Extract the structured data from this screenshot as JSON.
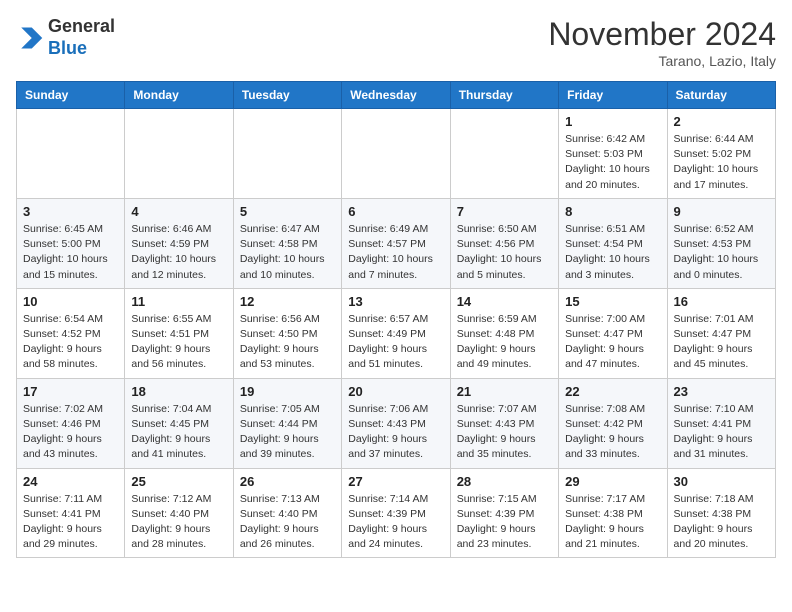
{
  "header": {
    "logo_line1": "General",
    "logo_line2": "Blue",
    "month": "November 2024",
    "location": "Tarano, Lazio, Italy"
  },
  "weekdays": [
    "Sunday",
    "Monday",
    "Tuesday",
    "Wednesday",
    "Thursday",
    "Friday",
    "Saturday"
  ],
  "weeks": [
    [
      {
        "day": "",
        "info": ""
      },
      {
        "day": "",
        "info": ""
      },
      {
        "day": "",
        "info": ""
      },
      {
        "day": "",
        "info": ""
      },
      {
        "day": "",
        "info": ""
      },
      {
        "day": "1",
        "info": "Sunrise: 6:42 AM\nSunset: 5:03 PM\nDaylight: 10 hours\nand 20 minutes."
      },
      {
        "day": "2",
        "info": "Sunrise: 6:44 AM\nSunset: 5:02 PM\nDaylight: 10 hours\nand 17 minutes."
      }
    ],
    [
      {
        "day": "3",
        "info": "Sunrise: 6:45 AM\nSunset: 5:00 PM\nDaylight: 10 hours\nand 15 minutes."
      },
      {
        "day": "4",
        "info": "Sunrise: 6:46 AM\nSunset: 4:59 PM\nDaylight: 10 hours\nand 12 minutes."
      },
      {
        "day": "5",
        "info": "Sunrise: 6:47 AM\nSunset: 4:58 PM\nDaylight: 10 hours\nand 10 minutes."
      },
      {
        "day": "6",
        "info": "Sunrise: 6:49 AM\nSunset: 4:57 PM\nDaylight: 10 hours\nand 7 minutes."
      },
      {
        "day": "7",
        "info": "Sunrise: 6:50 AM\nSunset: 4:56 PM\nDaylight: 10 hours\nand 5 minutes."
      },
      {
        "day": "8",
        "info": "Sunrise: 6:51 AM\nSunset: 4:54 PM\nDaylight: 10 hours\nand 3 minutes."
      },
      {
        "day": "9",
        "info": "Sunrise: 6:52 AM\nSunset: 4:53 PM\nDaylight: 10 hours\nand 0 minutes."
      }
    ],
    [
      {
        "day": "10",
        "info": "Sunrise: 6:54 AM\nSunset: 4:52 PM\nDaylight: 9 hours\nand 58 minutes."
      },
      {
        "day": "11",
        "info": "Sunrise: 6:55 AM\nSunset: 4:51 PM\nDaylight: 9 hours\nand 56 minutes."
      },
      {
        "day": "12",
        "info": "Sunrise: 6:56 AM\nSunset: 4:50 PM\nDaylight: 9 hours\nand 53 minutes."
      },
      {
        "day": "13",
        "info": "Sunrise: 6:57 AM\nSunset: 4:49 PM\nDaylight: 9 hours\nand 51 minutes."
      },
      {
        "day": "14",
        "info": "Sunrise: 6:59 AM\nSunset: 4:48 PM\nDaylight: 9 hours\nand 49 minutes."
      },
      {
        "day": "15",
        "info": "Sunrise: 7:00 AM\nSunset: 4:47 PM\nDaylight: 9 hours\nand 47 minutes."
      },
      {
        "day": "16",
        "info": "Sunrise: 7:01 AM\nSunset: 4:47 PM\nDaylight: 9 hours\nand 45 minutes."
      }
    ],
    [
      {
        "day": "17",
        "info": "Sunrise: 7:02 AM\nSunset: 4:46 PM\nDaylight: 9 hours\nand 43 minutes."
      },
      {
        "day": "18",
        "info": "Sunrise: 7:04 AM\nSunset: 4:45 PM\nDaylight: 9 hours\nand 41 minutes."
      },
      {
        "day": "19",
        "info": "Sunrise: 7:05 AM\nSunset: 4:44 PM\nDaylight: 9 hours\nand 39 minutes."
      },
      {
        "day": "20",
        "info": "Sunrise: 7:06 AM\nSunset: 4:43 PM\nDaylight: 9 hours\nand 37 minutes."
      },
      {
        "day": "21",
        "info": "Sunrise: 7:07 AM\nSunset: 4:43 PM\nDaylight: 9 hours\nand 35 minutes."
      },
      {
        "day": "22",
        "info": "Sunrise: 7:08 AM\nSunset: 4:42 PM\nDaylight: 9 hours\nand 33 minutes."
      },
      {
        "day": "23",
        "info": "Sunrise: 7:10 AM\nSunset: 4:41 PM\nDaylight: 9 hours\nand 31 minutes."
      }
    ],
    [
      {
        "day": "24",
        "info": "Sunrise: 7:11 AM\nSunset: 4:41 PM\nDaylight: 9 hours\nand 29 minutes."
      },
      {
        "day": "25",
        "info": "Sunrise: 7:12 AM\nSunset: 4:40 PM\nDaylight: 9 hours\nand 28 minutes."
      },
      {
        "day": "26",
        "info": "Sunrise: 7:13 AM\nSunset: 4:40 PM\nDaylight: 9 hours\nand 26 minutes."
      },
      {
        "day": "27",
        "info": "Sunrise: 7:14 AM\nSunset: 4:39 PM\nDaylight: 9 hours\nand 24 minutes."
      },
      {
        "day": "28",
        "info": "Sunrise: 7:15 AM\nSunset: 4:39 PM\nDaylight: 9 hours\nand 23 minutes."
      },
      {
        "day": "29",
        "info": "Sunrise: 7:17 AM\nSunset: 4:38 PM\nDaylight: 9 hours\nand 21 minutes."
      },
      {
        "day": "30",
        "info": "Sunrise: 7:18 AM\nSunset: 4:38 PM\nDaylight: 9 hours\nand 20 minutes."
      }
    ]
  ]
}
